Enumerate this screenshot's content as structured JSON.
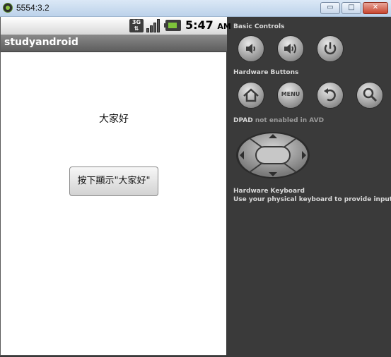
{
  "window": {
    "title": "5554:3.2",
    "minimize": "▭",
    "maximize": "□",
    "close": "✕"
  },
  "status_bar": {
    "network": "3G",
    "time": "5:47",
    "ampm": "AM"
  },
  "app": {
    "title": "studyandroid",
    "text": "大家好",
    "button_label": "按下顯示\"大家好\""
  },
  "controls": {
    "basic_label": "Basic Controls",
    "hardware_label": "Hardware Buttons",
    "menu_label": "MENU",
    "dpad_label": "DPAD",
    "dpad_status": " not enabled in AVD",
    "keyboard_label": "Hardware Keyboard",
    "keyboard_hint": "Use your physical keyboard to provide input"
  }
}
